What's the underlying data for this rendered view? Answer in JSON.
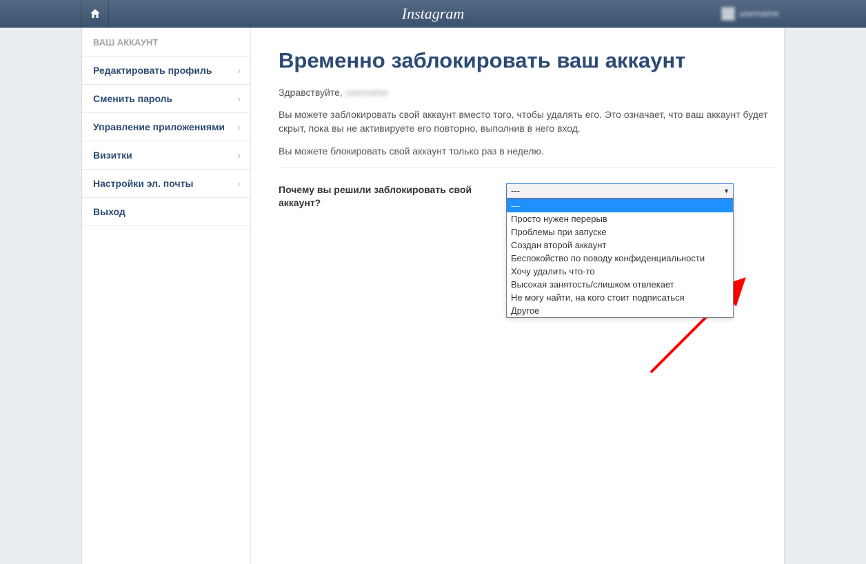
{
  "header": {
    "brand": "Instagram",
    "username": "username"
  },
  "sidebar": {
    "header": "ВАШ АККАУНТ",
    "items": [
      {
        "label": "Редактировать профиль",
        "chevron": true
      },
      {
        "label": "Сменить пароль",
        "chevron": true
      },
      {
        "label": "Управление приложениями",
        "chevron": true
      },
      {
        "label": "Визитки",
        "chevron": true
      },
      {
        "label": "Настройки эл. почты",
        "chevron": true
      },
      {
        "label": "Выход",
        "chevron": false
      }
    ]
  },
  "main": {
    "title": "Временно заблокировать ваш аккаунт",
    "greeting_prefix": "Здравствуйте, ",
    "greeting_name": "username",
    "para1": "Вы можете заблокировать свой аккаунт вместо того, чтобы удалять его. Это означает, что ваш аккаунт будет скрыт, пока вы не активируете его повторно, выполнив в него вход.",
    "para2": "Вы можете блокировать свой аккаунт только раз в неделю.",
    "question": "Почему вы решили заблокировать свой аккаунт?",
    "select_value": "---",
    "options": [
      "---",
      "Просто нужен перерыв",
      "Проблемы при запуске",
      "Создан второй аккаунт",
      "Беспокойство по поводу конфиденциальности",
      "Хочу удалить что-то",
      "Высокая занятость/слишком отвлекает",
      "Не могу найти, на кого стоит подписаться",
      "Другое"
    ]
  }
}
